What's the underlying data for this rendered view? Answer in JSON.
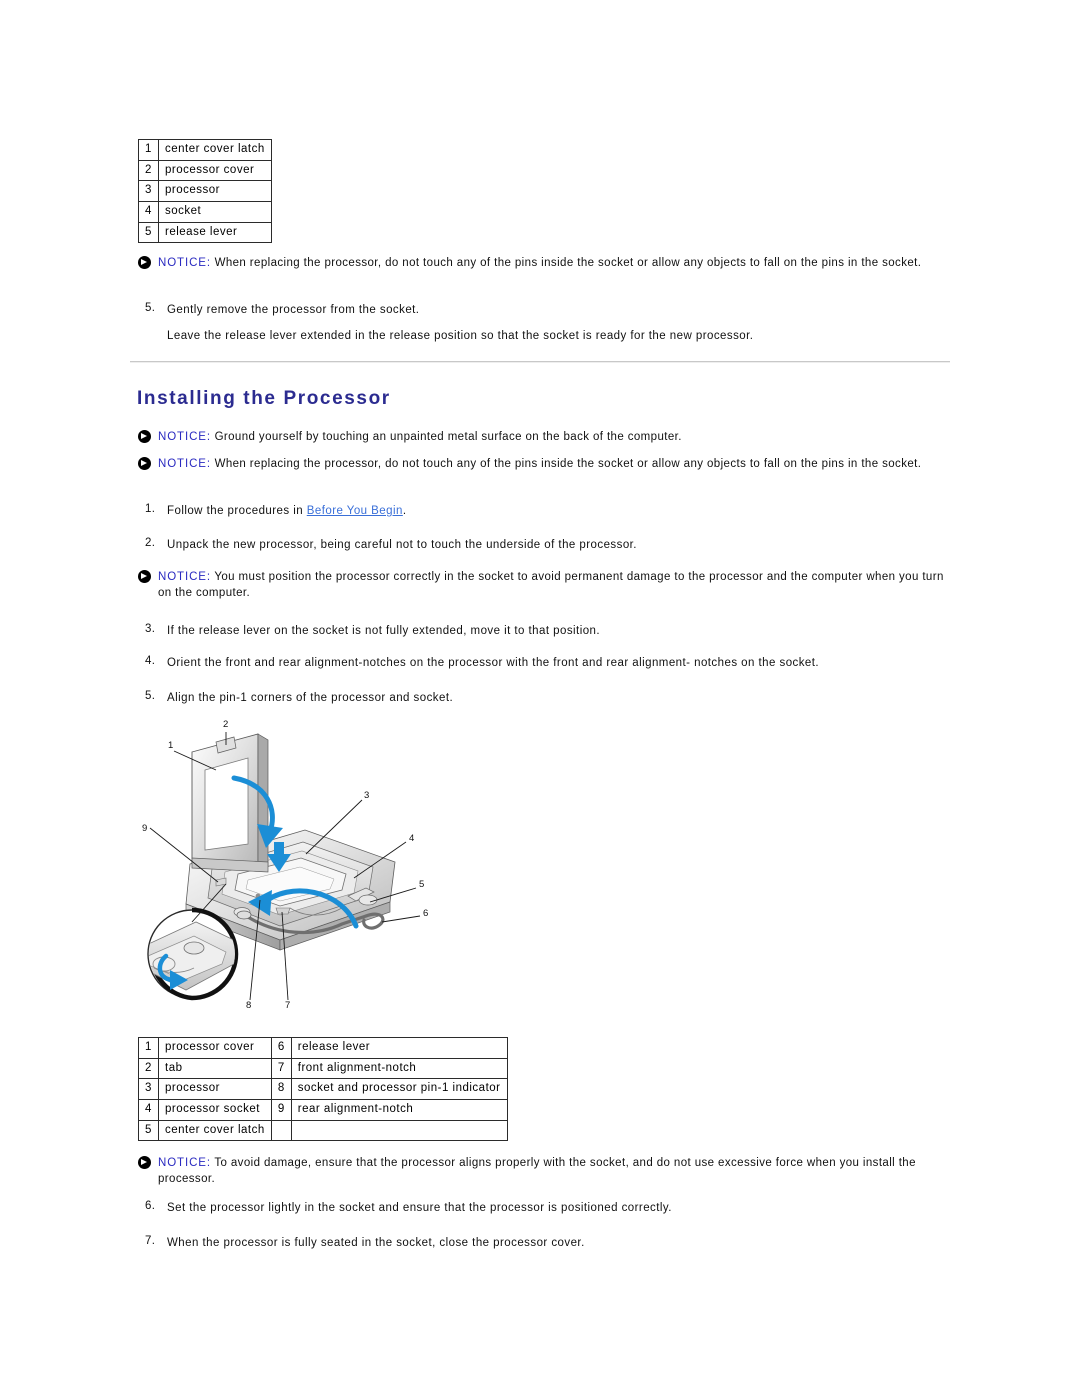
{
  "document": {
    "section_heading": "Installing the Processor"
  },
  "legend_top": {
    "rows": [
      {
        "num": "1",
        "label": "center cover latch"
      },
      {
        "num": "2",
        "label": "processor cover"
      },
      {
        "num": "3",
        "label": "processor"
      },
      {
        "num": "4",
        "label": "socket"
      },
      {
        "num": "5",
        "label": "release lever"
      }
    ]
  },
  "legend_bottom": {
    "rows": [
      {
        "num1": "1",
        "label1": "processor cover",
        "num2": "6",
        "label2": "release lever"
      },
      {
        "num1": "2",
        "label1": "tab",
        "num2": "7",
        "label2": "front alignment-notch"
      },
      {
        "num1": "3",
        "label1": "processor",
        "num2": "8",
        "label2": "socket and processor pin-1 indicator"
      },
      {
        "num1": "4",
        "label1": "processor socket",
        "num2": "9",
        "label2": "rear alignment-notch"
      },
      {
        "num1": "5",
        "label1": "center cover latch",
        "num2": "",
        "label2": ""
      }
    ]
  },
  "notices": {
    "label": "NOTICE:",
    "removal_pins": "When replacing the processor, do not touch any of the pins inside the socket or allow any objects to fall on the pins in the socket.",
    "ground_yourself": "Ground yourself by touching an unpainted metal surface on the back of the computer.",
    "install_pins": "When replacing the processor, do not touch any of the pins inside the socket or allow any objects to fall on the pins in the socket.",
    "position_correctly": "You must position the processor correctly in the socket to avoid permanent damage to the processor and the computer when you turn on the computer.",
    "avoid_damage": "To avoid damage, ensure that the processor aligns properly with the socket, and do not use excessive force when you install the processor."
  },
  "removal_steps": {
    "step5_num": "5.",
    "step5_text": "Gently remove the processor from the socket.",
    "step5_note": "Leave the release lever extended in the release position so that the socket is ready for the new processor."
  },
  "install_steps": [
    {
      "num": "1.",
      "text_before": "Follow the procedures in ",
      "link": "Before You Begin",
      "text_after": "."
    },
    {
      "num": "2.",
      "text": "Unpack the new processor, being careful not to touch the underside of the processor."
    },
    {
      "num": "3.",
      "text": "If the release lever on the socket is not fully extended, move it to that position."
    },
    {
      "num": "4.",
      "text": "Orient the front and rear alignment-notches on the processor with the front and rear alignment- notches on the socket."
    },
    {
      "num": "5.",
      "text": "Align the pin-1 corners of the processor and socket."
    },
    {
      "num": "6.",
      "text": "Set the processor lightly in the socket and ensure that the processor is positioned correctly."
    },
    {
      "num": "7.",
      "text": "When the processor is fully seated in the socket, close the processor cover."
    }
  ],
  "figure": {
    "callouts": [
      "1",
      "2",
      "3",
      "4",
      "5",
      "6",
      "7",
      "8",
      "9"
    ],
    "description": "Exploded view of processor socket with hinged processor cover, release lever and magnified pin-1 detail inset"
  },
  "colors": {
    "notice_label": "#2a2ac0",
    "heading": "#2b2b90",
    "link": "#3a6fd8",
    "arrow_blue": "#1b8ed6",
    "rule": "#c8c8c8",
    "text": "#111111"
  }
}
